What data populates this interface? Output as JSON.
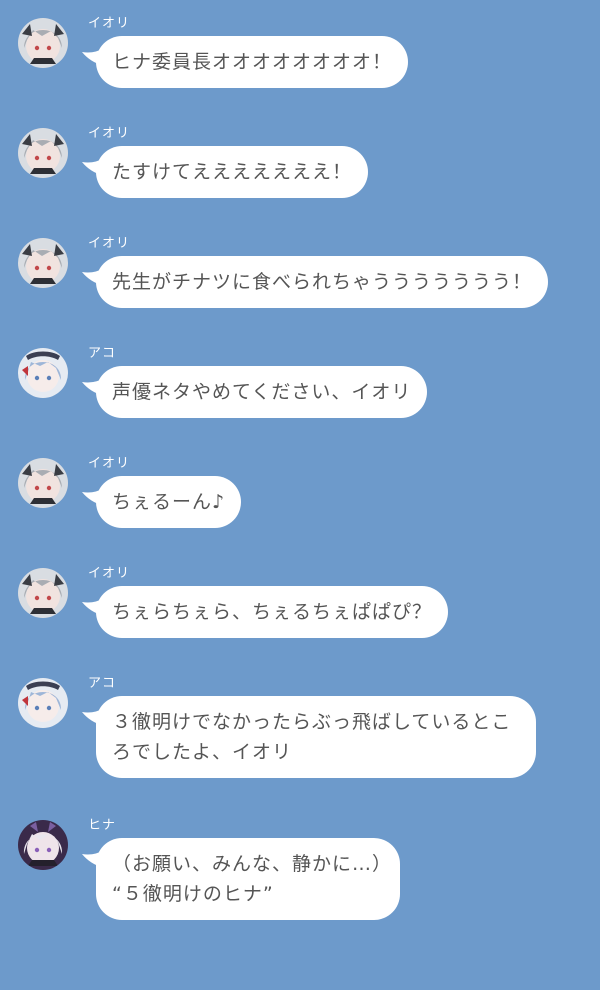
{
  "chat": {
    "messages": [
      {
        "sender": "イオリ",
        "avatar": "iori-avatar",
        "lines": [
          "ヒナ委員長オオオオオオオオ！"
        ]
      },
      {
        "sender": "イオリ",
        "avatar": "iori-avatar",
        "lines": [
          "たすけてえええええええ！"
        ]
      },
      {
        "sender": "イオリ",
        "avatar": "iori-avatar",
        "lines": [
          "先生がチナツに食べられちゃううううううう！"
        ]
      },
      {
        "sender": "アコ",
        "avatar": "ako-avatar",
        "lines": [
          "声優ネタやめてください、イオリ"
        ]
      },
      {
        "sender": "イオリ",
        "avatar": "iori-avatar",
        "lines": [
          "ちぇるーん♪"
        ]
      },
      {
        "sender": "イオリ",
        "avatar": "iori-avatar",
        "lines": [
          "ちぇらちぇら、ちぇるちぇぱぱぴ？"
        ]
      },
      {
        "sender": "アコ",
        "avatar": "ako-avatar",
        "lines": [
          "３徹明けでなかったらぶっ飛ばしているとこ",
          "ろでしたよ、イオリ"
        ]
      },
      {
        "sender": "ヒナ",
        "avatar": "hina-avatar",
        "lines": [
          "（お願い、みんな、静かに…）",
          "“５徹明けのヒナ”"
        ]
      }
    ]
  },
  "colors": {
    "background": "#6d9acb",
    "bubble": "#ffffff",
    "text": "#555555",
    "sender_name": "#ffffff"
  }
}
